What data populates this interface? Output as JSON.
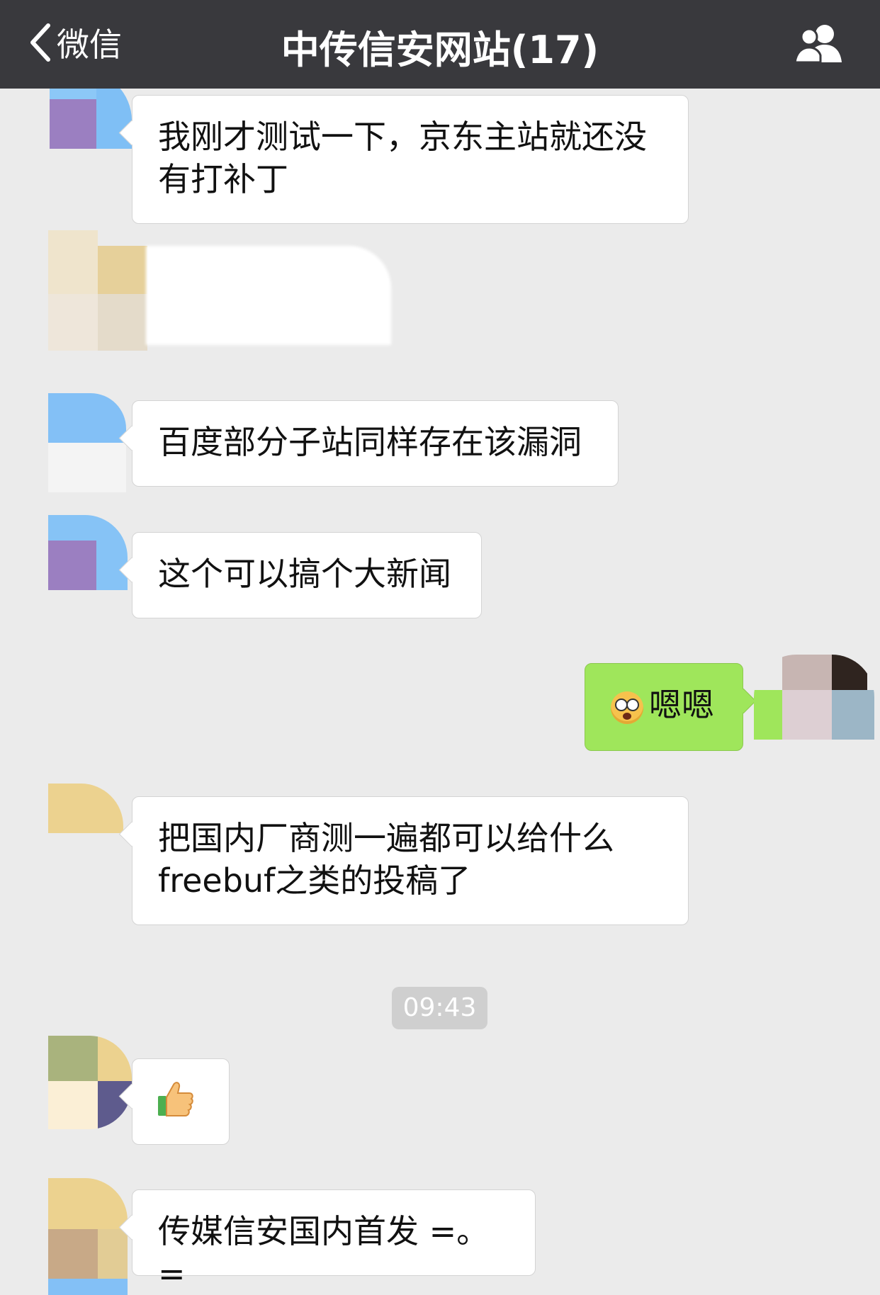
{
  "header": {
    "back_label": "微信",
    "title": "中传信安网站(17)",
    "back_icon": "chevron-left-icon",
    "members_icon": "group-members-icon"
  },
  "messages": [
    {
      "side": "left",
      "text": "我刚才测试一下，京东主站就还没有打补丁"
    },
    {
      "side": "left",
      "text": ""
    },
    {
      "side": "left",
      "text": "百度部分子站同样存在该漏洞"
    },
    {
      "side": "left",
      "text": "这个可以搞个大新闻"
    },
    {
      "side": "right",
      "emoji": "angry-face-emoji",
      "text": "嗯嗯"
    },
    {
      "side": "left",
      "text": "把国内厂商测一遍都可以给什么freebuf之类的投稿了"
    },
    {
      "side": "left",
      "emoji": "thumbs-up-emoji",
      "text": ""
    },
    {
      "side": "left",
      "text": "传媒信安国内首发 =。="
    }
  ],
  "timestamp": "09:43",
  "colors": {
    "topbar": "#39393d",
    "background": "#ebebeb",
    "bubble_left": "#ffffff",
    "bubble_right": "#9fe65b"
  }
}
